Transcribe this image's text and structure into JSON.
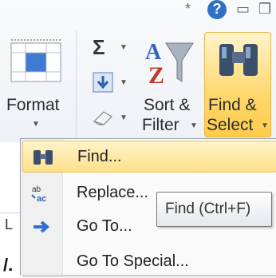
{
  "ribbon": {
    "format_label": "Format",
    "sort_filter": {
      "line1": "Sort &",
      "line2": "Filter"
    },
    "find_select": {
      "line1": "Find &",
      "line2": "Select"
    },
    "autosum_glyph": "Σ"
  },
  "menu": {
    "items": [
      {
        "label": "Find...",
        "icon": "binoculars-icon",
        "highlighted": true
      },
      {
        "label": "Replace...",
        "icon": "replace-icon"
      },
      {
        "label": "Go To...",
        "icon": "arrow-right-icon"
      },
      {
        "label": "Go To Special...",
        "icon": ""
      }
    ]
  },
  "tooltip": {
    "text": "Find (Ctrl+F)"
  },
  "sheet": {
    "cell_text_1": "L",
    "cell_text_2": "/."
  },
  "colors": {
    "accent_yellow": "#ffd76e",
    "menu_bg": "#fafafa",
    "tooltip_border": "#767676"
  }
}
